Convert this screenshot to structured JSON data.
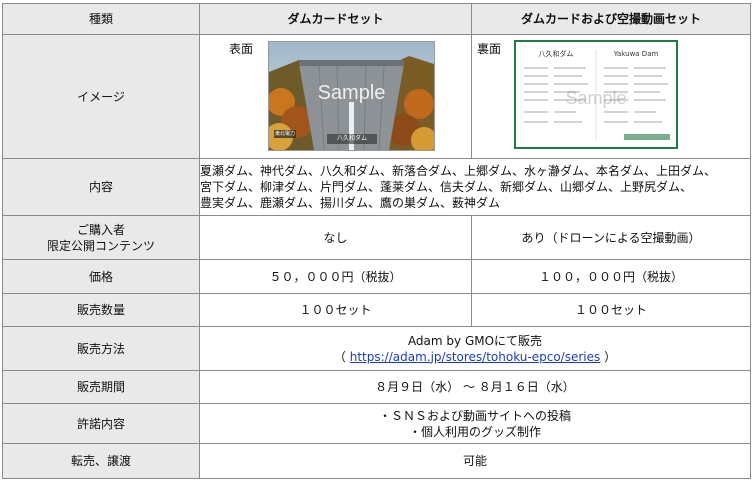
{
  "header": {
    "col1": "種類",
    "col2": "ダムカードセット",
    "col3": "ダムカードおよび空撮動画セット"
  },
  "image_row": {
    "label": "イメージ",
    "front_label": "表面",
    "back_label": "裏面",
    "front_card": {
      "watermark": "Sample",
      "caption": "八久和ダム",
      "badge": "東北電力"
    },
    "back_card": {
      "title_jp": "八久和ダム",
      "title_en": "Yakuwa Dam",
      "watermark": "Sample"
    }
  },
  "content_row": {
    "label": "内容",
    "lines": [
      "夏瀬ダム、神代ダム、八久和ダム、新落合ダム、上郷ダム、水ヶ瀞ダム、本名ダム、上田ダム、",
      "宮下ダム、柳津ダム、片門ダム、蓬莱ダム、信夫ダム、新郷ダム、山郷ダム、上野尻ダム、",
      "豊実ダム、鹿瀬ダム、揚川ダム、鷹の巣ダム、薮神ダム"
    ]
  },
  "exclusive_row": {
    "label_line1": "ご購入者",
    "label_line2": "限定公開コンテンツ",
    "col2": "なし",
    "col3": "あり（ドローンによる空撮動画）"
  },
  "price_row": {
    "label": "価格",
    "col2": "５０，０００円（税抜）",
    "col3": "１００，０００円（税抜）"
  },
  "quantity_row": {
    "label": "販売数量",
    "col2": "１００セット",
    "col3": "１００セット"
  },
  "method_row": {
    "label": "販売方法",
    "line1": "Adam by GMOにて販売",
    "paren_open": "（ ",
    "url": "https://adam.jp/stores/tohoku-epco/series",
    "paren_close": " ）"
  },
  "period_row": {
    "label": "販売期間",
    "value": "８月９日（水） ～ ８月１６日（水）"
  },
  "license_row": {
    "label": "許諾内容",
    "line1": "・ＳＮＳおよび動画サイトへの投稿",
    "line2": "・個人利用のグッズ制作"
  },
  "resale_row": {
    "label": "転売、譲渡",
    "value": "可能"
  }
}
